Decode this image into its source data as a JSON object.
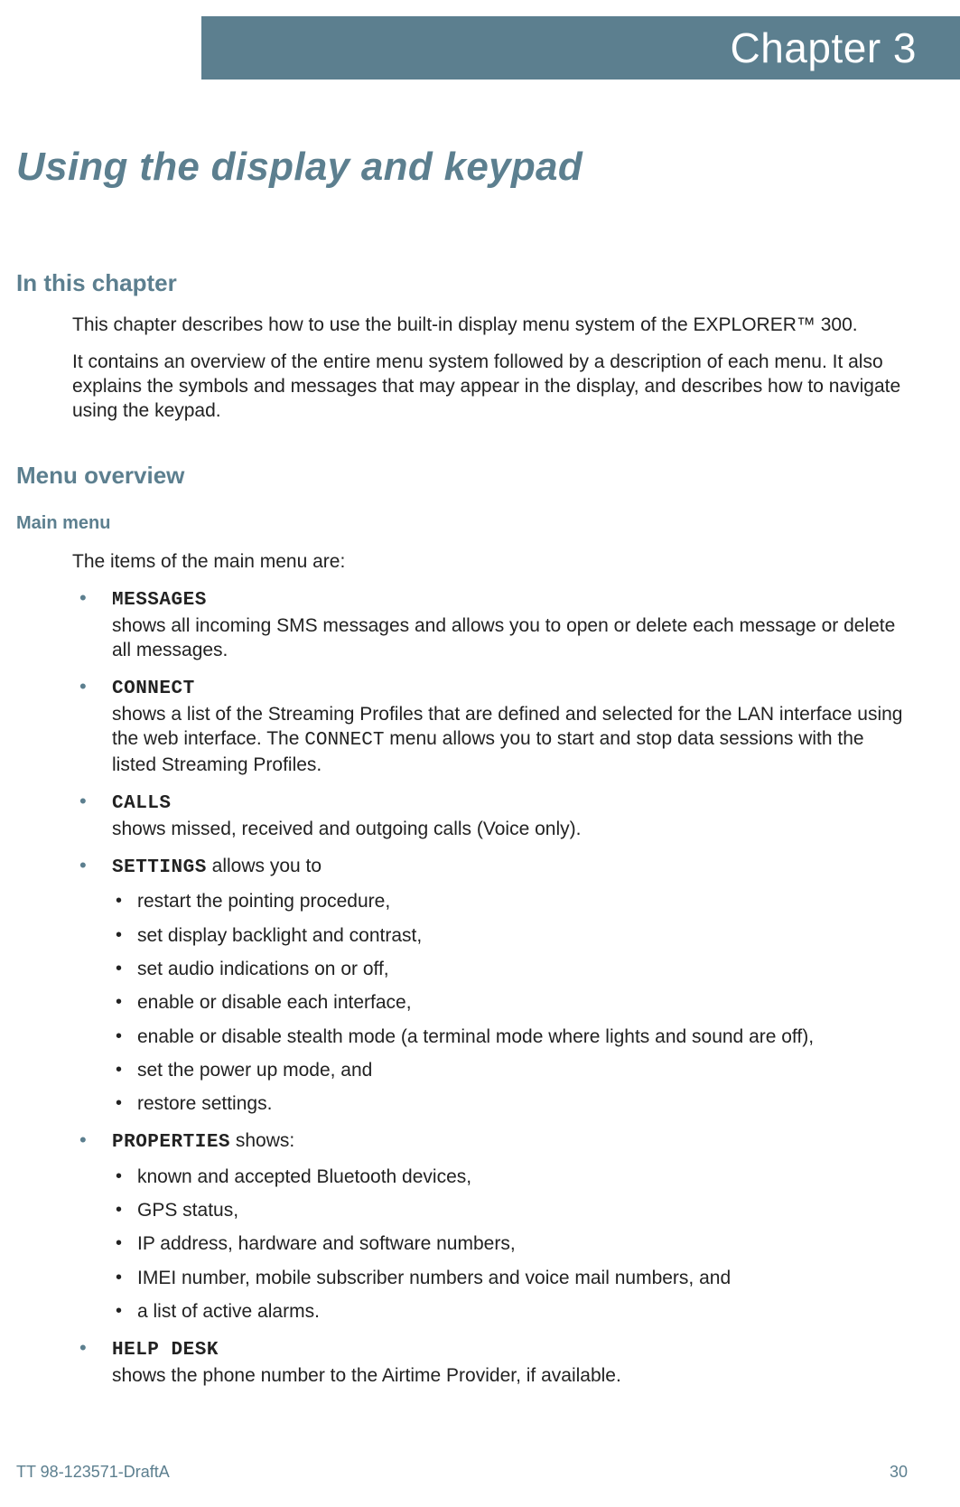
{
  "header": {
    "chapter_label": "Chapter 3"
  },
  "title": "Using the display and keypad",
  "sections": {
    "in_this": {
      "heading": "In this chapter",
      "p1": "This chapter describes how to use the built-in display menu system of the EXPLORER™ 300.",
      "p2": "It contains an overview of the entire menu system followed by a description of each menu. It also explains the symbols and messages that may appear in the display, and describes how to navigate using the keypad."
    },
    "overview": {
      "heading": "Menu overview",
      "main_menu_heading": "Main menu",
      "intro": "The items of the main menu are:",
      "items": [
        {
          "label": "MESSAGES",
          "desc_prefix": "",
          "desc": "shows all incoming SMS messages and allows you to open or delete each message or delete all messages."
        },
        {
          "label": "CONNECT",
          "desc_prefix": "",
          "desc_a": "shows a list of the Streaming Profiles that are defined and selected for the LAN interface using the web interface. The ",
          "desc_mono": "CONNECT",
          "desc_b": " menu allows you to start and stop data sessions with the listed Streaming Profiles."
        },
        {
          "label": "CALLS",
          "desc": "shows missed, received and outgoing calls (Voice only)."
        },
        {
          "label": "SETTINGS",
          "after_label": " allows you to",
          "sub": [
            "restart the pointing procedure,",
            "set display backlight and contrast,",
            "set audio indications on or off,",
            "enable or disable each interface,",
            "enable or disable stealth mode (a terminal mode where lights and sound are off),",
            "set the power up mode, and",
            "restore settings."
          ]
        },
        {
          "label": "PROPERTIES",
          "after_label": " shows:",
          "sub": [
            "known and accepted Bluetooth devices,",
            "GPS status,",
            "IP address, hardware and software numbers,",
            "IMEI number, mobile subscriber numbers and voice mail numbers, and",
            "a list of active alarms."
          ]
        },
        {
          "label": "HELP DESK",
          "desc": "shows the phone number to the Airtime Provider, if available."
        }
      ]
    }
  },
  "footer": {
    "doc_id": "TT 98-123571-DraftA",
    "page_num": "30"
  }
}
